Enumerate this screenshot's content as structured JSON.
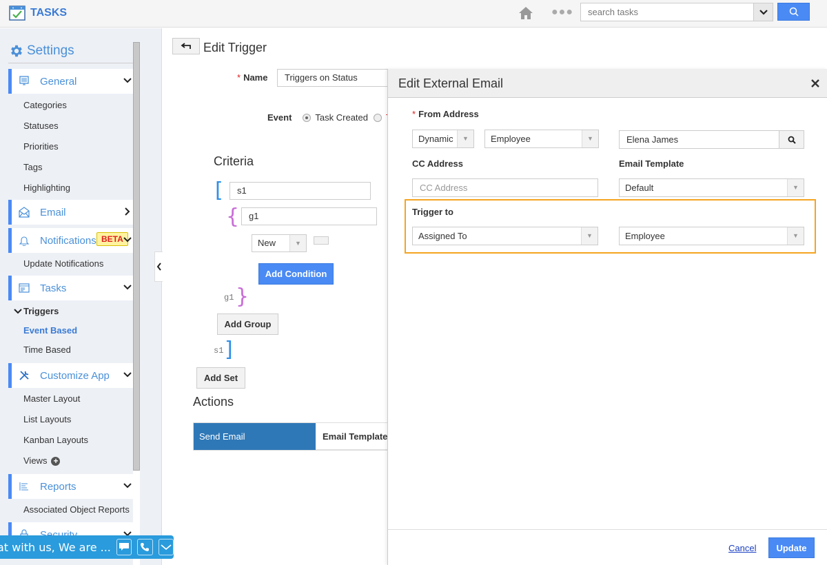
{
  "app": {
    "title": "TASKS"
  },
  "topbar": {
    "search_placeholder": "search tasks",
    "home_icon": "home-icon",
    "more_icon": "more-dots-icon",
    "search_icon": "search-icon"
  },
  "sidebar": {
    "title": "Settings",
    "sections": {
      "general": {
        "label": "General",
        "items": [
          "Categories",
          "Statuses",
          "Priorities",
          "Tags",
          "Highlighting"
        ]
      },
      "email": {
        "label": "Email"
      },
      "notifications": {
        "label": "Notifications",
        "badge": "BETA",
        "items": [
          "Update Notifications"
        ]
      },
      "tasks": {
        "label": "Tasks",
        "group": "Triggers",
        "items": [
          "Event Based",
          "Time Based"
        ],
        "active": "Event Based"
      },
      "customize": {
        "label": "Customize App",
        "items": [
          "Master Layout",
          "List Layouts",
          "Kanban Layouts",
          "Views"
        ]
      },
      "reports": {
        "label": "Reports",
        "items": [
          "Associated Object Reports"
        ]
      },
      "security": {
        "label": "Security"
      }
    }
  },
  "main": {
    "title": "Edit Trigger",
    "name_label": "Name",
    "name_value": "Triggers on Status",
    "event_label": "Event",
    "event_options": [
      "Task Created",
      "T"
    ],
    "event_selected": "Task Created",
    "criteria_title": "Criteria",
    "set_name": "s1",
    "group_name": "g1",
    "condition_value": "New",
    "add_condition": "Add Condition",
    "add_group": "Add Group",
    "add_set": "Add Set",
    "group_close_label": "g1",
    "set_close_label": "s1",
    "actions_title": "Actions",
    "action_type": "Send Email",
    "action_template_label": "Email Template:"
  },
  "modal": {
    "title": "Edit External Email",
    "from_label": "From Address",
    "from_type": "Dynamic",
    "from_module": "Employee",
    "from_value": "Elena James",
    "cc_label": "CC Address",
    "cc_placeholder": "CC Address",
    "template_label": "Email Template",
    "template_value": "Default",
    "trigger_label": "Trigger to",
    "trigger_field": "Assigned To",
    "trigger_module": "Employee",
    "cancel": "Cancel",
    "update": "Update",
    "highlight_color": "#f5a41f"
  },
  "chat": {
    "text": "at with us, We are ..."
  },
  "colors": {
    "accent": "#4a8af4",
    "action": "#2f78b7",
    "chat": "#2a9bdc"
  }
}
